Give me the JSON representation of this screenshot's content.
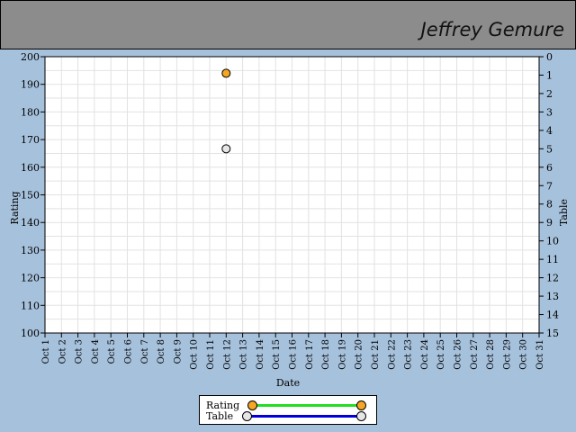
{
  "header": {
    "player_name": "Jeffrey Gemure"
  },
  "colors": {
    "background": "#a6c1db",
    "header": "#8c8c8c",
    "rating": "#f5a623",
    "table_marker": "#e6e6e6",
    "rating_line": "#22dd22",
    "table_line": "#0000dd"
  },
  "chart_data": {
    "type": "scatter",
    "xlabel": "Date",
    "ylabel": "Rating",
    "y2label": "Table",
    "categories": [
      "Oct 1",
      "Oct 2",
      "Oct 3",
      "Oct 4",
      "Oct 5",
      "Oct 6",
      "Oct 7",
      "Oct 8",
      "Oct 9",
      "Oct 10",
      "Oct 11",
      "Oct 12",
      "Oct 13",
      "Oct 14",
      "Oct 15",
      "Oct 16",
      "Oct 17",
      "Oct 18",
      "Oct 19",
      "Oct 20",
      "Oct 21",
      "Oct 22",
      "Oct 23",
      "Oct 24",
      "Oct 25",
      "Oct 26",
      "Oct 27",
      "Oct 28",
      "Oct 29",
      "Oct 30",
      "Oct 31"
    ],
    "ylim": [
      100,
      200
    ],
    "yticks": [
      100,
      110,
      120,
      130,
      140,
      150,
      160,
      170,
      180,
      190,
      200
    ],
    "y2lim": [
      0,
      15
    ],
    "y2ticks": [
      0,
      1,
      2,
      3,
      4,
      5,
      6,
      7,
      8,
      9,
      10,
      11,
      12,
      13,
      14,
      15
    ],
    "y2_inverted": true,
    "grid": true,
    "legend_position": "bottom-center",
    "series": [
      {
        "name": "Rating",
        "axis": "left",
        "points": [
          {
            "x": "Oct 12",
            "y": 194
          }
        ]
      },
      {
        "name": "Table",
        "axis": "right",
        "points": [
          {
            "x": "Oct 12",
            "y": 5
          }
        ]
      }
    ]
  }
}
